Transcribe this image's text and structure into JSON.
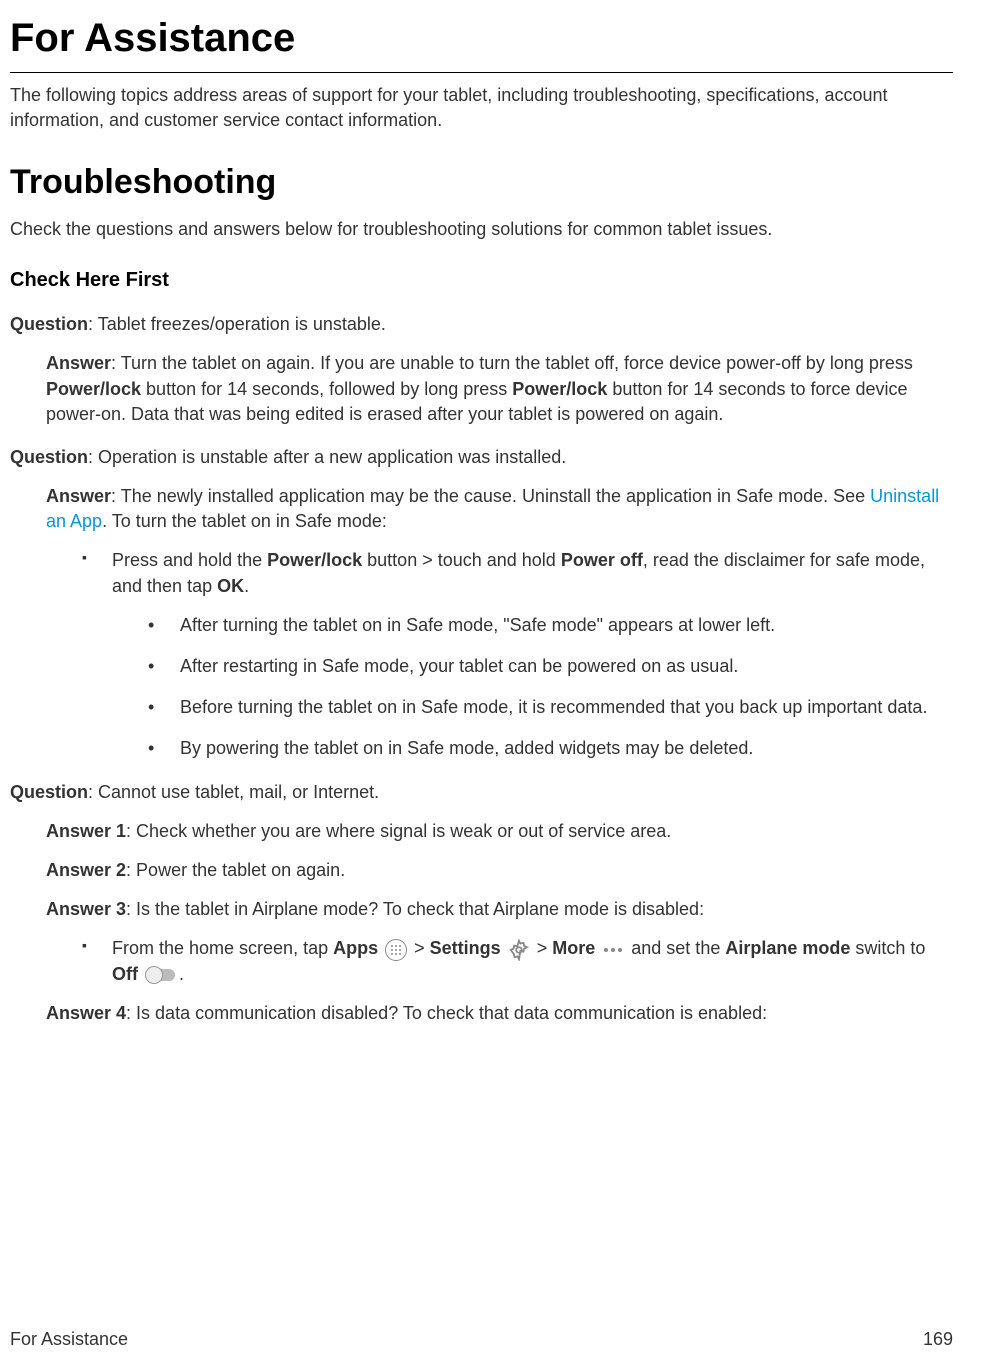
{
  "h1_main": "For Assistance",
  "intro1": "The following topics address areas of support for your tablet, including troubleshooting, specifications, account information, and customer service contact information.",
  "h1_trouble": "Troubleshooting",
  "intro2": "Check the questions and answers below for troubleshooting solutions for common tablet issues.",
  "h2_check": "Check Here First",
  "q1_label": "Question",
  "q1_text": ": Tablet freezes/operation is unstable.",
  "a1_label": "Answer",
  "a1_p1": ": Turn the tablet on again. If you are unable to turn the tablet off, force device power-off by long press ",
  "a1_b1": "Power/lock",
  "a1_p2": " button for 14 seconds, followed by long press ",
  "a1_b2": "Power/lock",
  "a1_p3": " button for 14 seconds to force device power-on. Data that was being edited is erased after your tablet is powered on again.",
  "q2_label": "Question",
  "q2_text": ": Operation is unstable after a new application was installed.",
  "a2_label": "Answer",
  "a2_p1": ": The newly installed application may be the cause. Uninstall the application in Safe mode. See ",
  "a2_link": "Uninstall an App",
  "a2_p2": ". To turn the tablet on in Safe mode:",
  "sq_p1": "Press and hold the ",
  "sq_b1": "Power/lock",
  "sq_p2": " button > touch and hold ",
  "sq_b2": "Power off",
  "sq_p3": ", read the disclaimer for safe mode, and then tap ",
  "sq_b3": "OK",
  "sq_p4": ".",
  "sub1": "After turning the tablet on in Safe mode, \"Safe mode\" appears at lower left.",
  "sub2": "After restarting in Safe mode, your tablet can be powered on as usual.",
  "sub3": "Before turning the tablet on in Safe mode, it is recommended that you back up important data.",
  "sub4": "By powering the tablet on in Safe mode, added widgets may be deleted.",
  "q3_label": "Question",
  "q3_text": ": Cannot use tablet, mail, or Internet.",
  "a31_label": "Answer 1",
  "a31_text": ": Check whether you are where signal is weak or out of service area.",
  "a32_label": "Answer 2",
  "a32_text": ": Power the tablet on again.",
  "a33_label": "Answer 3",
  "a33_text": ": Is the tablet in Airplane mode? To check that Airplane mode is disabled:",
  "ap_p1": "From the home screen, tap ",
  "ap_b1": "Apps",
  "ap_p2": " > ",
  "ap_b2": "Settings",
  "ap_p3": " > ",
  "ap_b3": "More",
  "ap_p4": " and set the ",
  "ap_b4": "Airplane mode",
  "ap_p5": " switch to ",
  "ap_b5": "Off",
  "ap_p6": ".",
  "a34_label": "Answer 4",
  "a34_text": ": Is data communication disabled? To check that data communication is enabled:",
  "footer_title": "For Assistance",
  "footer_page": "169"
}
